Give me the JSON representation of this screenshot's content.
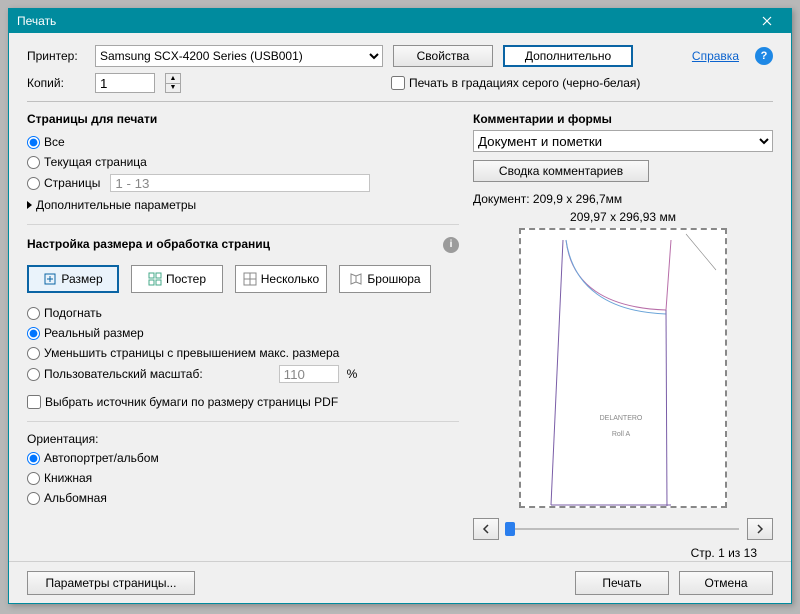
{
  "window": {
    "title": "Печать"
  },
  "top": {
    "printer_label": "Принтер:",
    "printer_value": "Samsung SCX-4200 Series (USB001)",
    "properties_btn": "Свойства",
    "advanced_btn": "Дополнительно",
    "help_link": "Справка",
    "copies_label": "Копий:",
    "copies_value": "1",
    "grayscale_label": "Печать в градациях серого (черно-белая)"
  },
  "pages": {
    "title": "Страницы для печати",
    "all": "Все",
    "current": "Текущая страница",
    "range": "Страницы",
    "range_value": "1 - 13",
    "more": "Дополнительные параметры"
  },
  "sizing": {
    "title": "Настройка размера и обработка страниц",
    "size": "Размер",
    "poster": "Постер",
    "multiple": "Несколько",
    "booklet": "Брошюра",
    "fit": "Подогнать",
    "actual": "Реальный размер",
    "shrink": "Уменьшить страницы с превышением макс. размера",
    "custom": "Пользовательский масштаб:",
    "custom_value": "110",
    "percent": "%",
    "source": "Выбрать источник бумаги по размеру страницы PDF"
  },
  "orientation": {
    "title": "Ориентация:",
    "auto": "Автопортрет/альбом",
    "portrait": "Книжная",
    "landscape": "Альбомная"
  },
  "comments": {
    "title": "Комментарии и формы",
    "value": "Документ и пометки",
    "summary_btn": "Сводка комментариев"
  },
  "preview": {
    "doc_label": "Документ: 209,9 x 296,7мм",
    "size_label": "209,97 x 296,93 мм",
    "page_indicator": "Стр. 1 из 13",
    "preview_text1": "DELANTERO",
    "preview_text2": "Roll A"
  },
  "footer": {
    "page_setup": "Параметры страницы...",
    "print": "Печать",
    "cancel": "Отмена"
  }
}
